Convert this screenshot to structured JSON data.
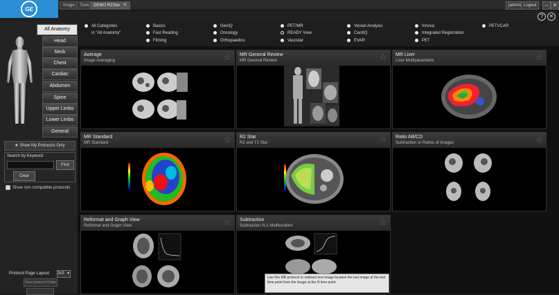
{
  "window": {
    "tabs": [
      {
        "label": "Image Browser",
        "active": false
      },
      {
        "label": "Tools",
        "active": false
      },
      {
        "label": "DEMO R2Star",
        "active": true
      }
    ],
    "user_label": "[admin]",
    "logout_label": "Logout",
    "help_label": "?"
  },
  "brand": {
    "logo_text": "GE"
  },
  "anatomy": {
    "selected": "All Anatomy",
    "items": [
      "All Anatomy",
      "Head",
      "Neck",
      "Chest",
      "Cardiac",
      "Abdomen",
      "Spine",
      "Upper Limbs",
      "Lower Limbs",
      "General"
    ]
  },
  "left": {
    "show_my_protocols": "Show My Protocols Only",
    "search_label": "Search by Keyword",
    "search_value": "",
    "find_label": "Find",
    "clear_label": "Clear",
    "show_noncompatible": "Show non compatible protocols",
    "page_layout_label": "Protocol Page Layout:",
    "page_layout_value": "3x3",
    "save_order_label": "Save protocol Order"
  },
  "categories": {
    "all": {
      "label": "All Categories",
      "sub": "in \"All Anatomy\""
    },
    "items": [
      {
        "label": "Basics"
      },
      {
        "label": "Fast Reading"
      },
      {
        "label": "Filming"
      },
      {
        "label": "GenIQ"
      },
      {
        "label": "Oncology"
      },
      {
        "label": "Orthopaedics"
      },
      {
        "label": "PET/MR"
      },
      {
        "label": "READY View",
        "selected": true
      },
      {
        "label": "Vascular"
      },
      {
        "label": "Vessel Analysis"
      },
      {
        "label": "CardIQ"
      },
      {
        "label": "EVAR"
      },
      {
        "label": "Innova"
      },
      {
        "label": "Integrated Registration"
      },
      {
        "label": "PET"
      },
      {
        "label": "PETVCAR"
      }
    ]
  },
  "protocols": [
    {
      "title": "Average",
      "subtitle": "Image Averaging",
      "icon": "star-icon"
    },
    {
      "title": "MR General Review",
      "subtitle": "MR General Review",
      "icon": "star-icon"
    },
    {
      "title": "MR Liver",
      "subtitle": "Liver Multiparametric",
      "icon": "star-icon"
    },
    {
      "title": "MR Standard",
      "subtitle": "MR Standard",
      "icon": "star-icon"
    },
    {
      "title": "R2 Star",
      "subtitle": "R2 and T2 Star",
      "icon": "star-icon"
    },
    {
      "title": "Ratio AB/CD",
      "subtitle": "Subtraction or Ratios of Images",
      "icon": "star-icon"
    },
    {
      "title": "Reformat and Graph View",
      "subtitle": "Reformat and Graph View",
      "icon": "star-icon"
    },
    {
      "title": "Subtraction",
      "subtitle": "Subtraction N-1 Multilocation",
      "icon": "star-icon",
      "tooltip": "Use this MR protocol to subtract one image location the last image at the last time point from the image at the N time point"
    }
  ],
  "colors": {
    "logo_bg": "#2a8fd6",
    "panel": "#232323",
    "selected_btn": "#e6e6e6"
  }
}
